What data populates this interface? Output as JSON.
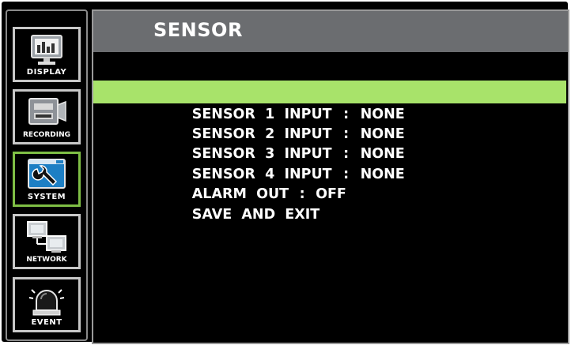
{
  "sidebar": {
    "items": [
      {
        "label": "DISPLAY",
        "icon": "monitor-icon",
        "active": false
      },
      {
        "label": "RECORDING",
        "icon": "camera-icon",
        "active": false
      },
      {
        "label": "SYSTEM",
        "icon": "wrench-icon",
        "active": true
      },
      {
        "label": "NETWORK",
        "icon": "network-icon",
        "active": false
      },
      {
        "label": "EVENT",
        "icon": "alarm-light-icon",
        "active": false
      }
    ]
  },
  "panel": {
    "title": "SENSOR",
    "menu": [
      {
        "label": "SENSOR  1  INPUT",
        "sep": ":",
        "value": "NONE",
        "selected": true
      },
      {
        "label": "SENSOR  2  INPUT",
        "sep": ":",
        "value": "NONE",
        "selected": false
      },
      {
        "label": "SENSOR  3  INPUT",
        "sep": ":",
        "value": "NONE",
        "selected": false
      },
      {
        "label": "SENSOR  4  INPUT",
        "sep": ":",
        "value": "NONE",
        "selected": false
      },
      {
        "label": "ALARM  OUT",
        "sep": ":",
        "value": "OFF",
        "selected": false
      },
      {
        "label": "SAVE  AND  EXIT",
        "sep": "",
        "value": "",
        "selected": false
      }
    ]
  },
  "colors": {
    "selection": "#a8e36a",
    "active_tile_border": "#7fbf45",
    "title_bar": "#6b6d70"
  }
}
